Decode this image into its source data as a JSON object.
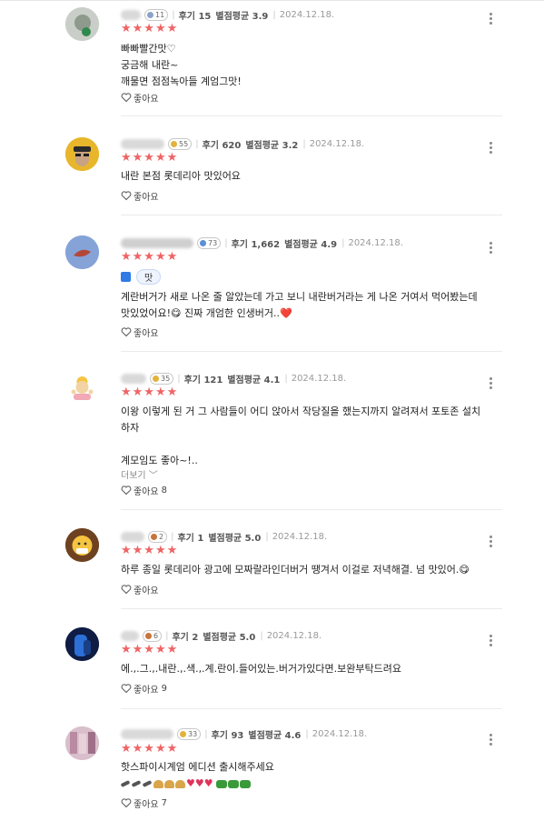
{
  "accent_star_color": "#ef6464",
  "reviews": [
    {
      "badge": "11",
      "badge_color": "#8aa3c7",
      "review_count_label": "후기 15",
      "avg_label": "별점평균 3.9",
      "date": "2024.12.18.",
      "stars": "★★★★★",
      "lines": [
        "빠빠빨간맛♡",
        "궁금해 내란~",
        "깨물면 점점녹아들 계엄그맛!"
      ],
      "like_label": "좋아요",
      "like_count": ""
    },
    {
      "badge": "55",
      "badge_color": "#e3b23c",
      "review_count_label": "후기 620",
      "avg_label": "별점평균 3.2",
      "date": "2024.12.18.",
      "stars": "★★★★★",
      "lines": [
        "내란 본점 롯데리아 맛있어요"
      ],
      "like_label": "좋아요",
      "like_count": ""
    },
    {
      "badge": "73",
      "badge_color": "#5b8fd6",
      "review_count_label": "후기 1,662",
      "avg_label": "별점평균 4.9",
      "date": "2024.12.18.",
      "stars": "★★★★★",
      "reaction_label": "맛",
      "lines": [
        "계란버거가 새로 나온 줄 알았는데 가고 보니 내란버거라는 게 나온 거여서 먹어봤는데",
        "맛있었어요!😋 진짜 개엄한 인생버거..❤️"
      ],
      "like_label": "좋아요",
      "like_count": ""
    },
    {
      "badge": "35",
      "badge_color": "#e3b23c",
      "review_count_label": "후기 121",
      "avg_label": "별점평균 4.1",
      "date": "2024.12.18.",
      "stars": "★★★★★",
      "lines": [
        "이왕 이렇게 된 거 그 사람들이 어디 앉아서 작당질을 했는지까지 알려져서 포토존 설치",
        "하자",
        "",
        "계모임도 좋아~!.."
      ],
      "more_label": "더보기 ﹀",
      "like_label": "좋아요",
      "like_count": "8"
    },
    {
      "badge": "2",
      "badge_color": "#c9743a",
      "review_count_label": "후기 1",
      "avg_label": "별점평균 5.0",
      "date": "2024.12.18.",
      "stars": "★★★★★",
      "lines": [
        "하루 종일 롯데리아 광고에 모짜랄라인더버거 땡겨서 이걸로 저녁해결. 넘 맛있어.😋"
      ],
      "like_label": "좋아요",
      "like_count": ""
    },
    {
      "badge": "6",
      "badge_color": "#c9743a",
      "review_count_label": "후기 2",
      "avg_label": "별점평균 5.0",
      "date": "2024.12.18.",
      "stars": "★★★★★",
      "lines": [
        "에.,.그.,.내란.,.색.,.계.란이.들어있는.버거가있다면.보완부탁드려요"
      ],
      "like_label": "좋아요",
      "like_count": "9"
    },
    {
      "badge": "33",
      "badge_color": "#e3b23c",
      "review_count_label": "후기 93",
      "avg_label": "별점평균 4.6",
      "date": "2024.12.18.",
      "stars": "★★★★★",
      "lines": [
        "핫스파이시계엄 에디션 출시해주세요"
      ],
      "like_label": "좋아요",
      "like_count": "7"
    }
  ]
}
